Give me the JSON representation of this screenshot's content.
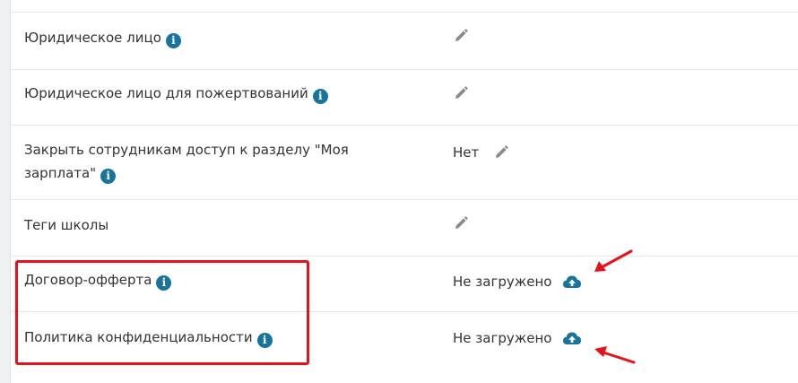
{
  "settings": {
    "rows": [
      {
        "label": "Юридическое лицо",
        "value": "",
        "action": "edit",
        "has_info": true
      },
      {
        "label": "Юридическое лицо для пожертвований",
        "value": "",
        "action": "edit",
        "has_info": true
      },
      {
        "label_line1": "Закрыть сотрудникам доступ к разделу \"Моя",
        "label_line2": "зарплата\"",
        "value": "Нет",
        "action": "edit",
        "has_info": true
      },
      {
        "label": "Теги школы",
        "value": "",
        "action": "edit",
        "has_info": false
      },
      {
        "label": "Договор-офферта",
        "value": "Не загружено",
        "action": "upload",
        "has_info": true
      },
      {
        "label": "Политика конфиденциальности",
        "value": "Не загружено",
        "action": "upload",
        "has_info": true
      }
    ]
  },
  "icons": {
    "info": "info-icon",
    "edit": "pencil-icon",
    "upload": "cloud-upload-icon",
    "annotation_arrow": "arrow-icon"
  },
  "colors": {
    "info_icon": "#18749c",
    "upload_icon": "#18749c",
    "pencil_icon": "#8a8a8a",
    "annotation": "#e8101a",
    "text": "#333333"
  }
}
